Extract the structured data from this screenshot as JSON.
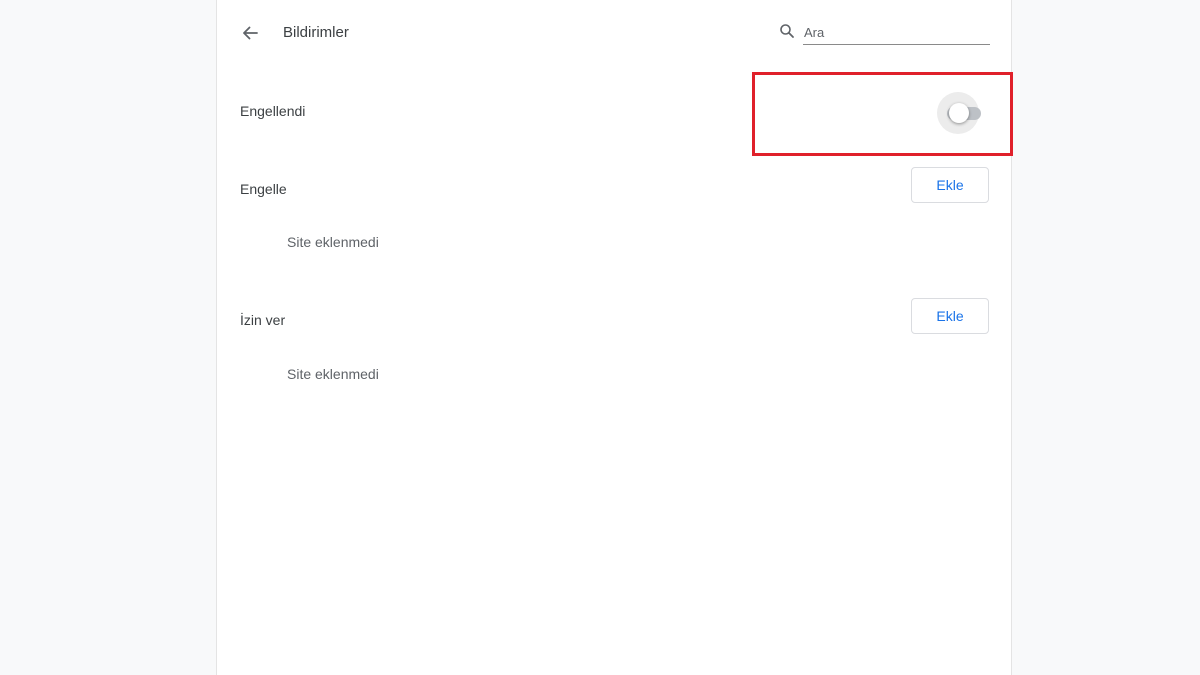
{
  "header": {
    "title": "Bildirimler",
    "back_icon": "arrow-left-icon"
  },
  "search": {
    "icon": "search-icon",
    "placeholder": "Ara"
  },
  "blocked_setting": {
    "label": "Engellendi",
    "toggle_on": false
  },
  "block_section": {
    "label": "Engelle",
    "add_label": "Ekle",
    "empty_text": "Site eklenmedi"
  },
  "allow_section": {
    "label": "İzin ver",
    "add_label": "Ekle",
    "empty_text": "Site eklenmedi"
  },
  "colors": {
    "accent": "#1a73e8",
    "highlight": "#e0202a"
  }
}
